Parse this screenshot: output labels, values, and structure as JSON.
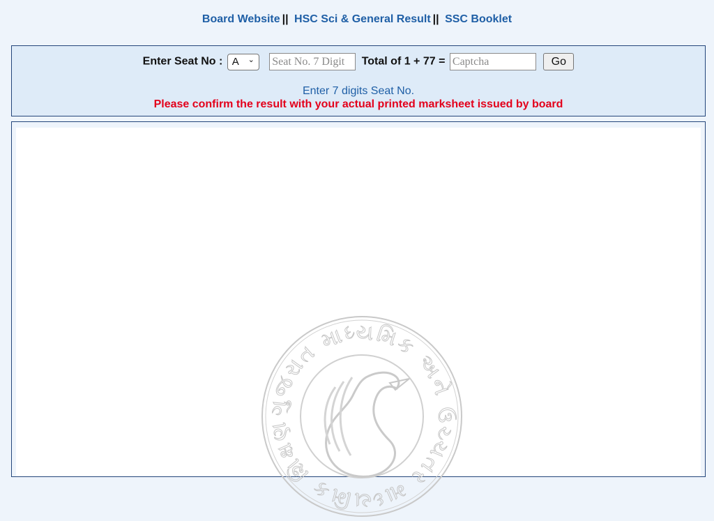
{
  "nav": {
    "links": [
      {
        "label": "Board Website"
      },
      {
        "label": "HSC Sci & General Result"
      },
      {
        "label": "SSC Booklet"
      }
    ],
    "separator": "||"
  },
  "form": {
    "seat_label": "Enter Seat No :",
    "series_value": "A",
    "seat_placeholder": "Seat No. 7 Digit",
    "captcha_question": "Total of 1 + 77 =",
    "captcha_placeholder": "Captcha",
    "go_label": "Go",
    "hint": "Enter 7 digits Seat No.",
    "warning": "Please confirm the result with your actual printed marksheet issued by board"
  },
  "result": {
    "watermark": "ગુજરાત માધ્યમિક અને ઉચ્ચતર માધ્યમિક શિક્ષણ બોર્ડ"
  },
  "colors": {
    "link": "#1f5fa6",
    "warning": "#e3001b",
    "panel": "#deebf8",
    "border": "#23457a"
  }
}
